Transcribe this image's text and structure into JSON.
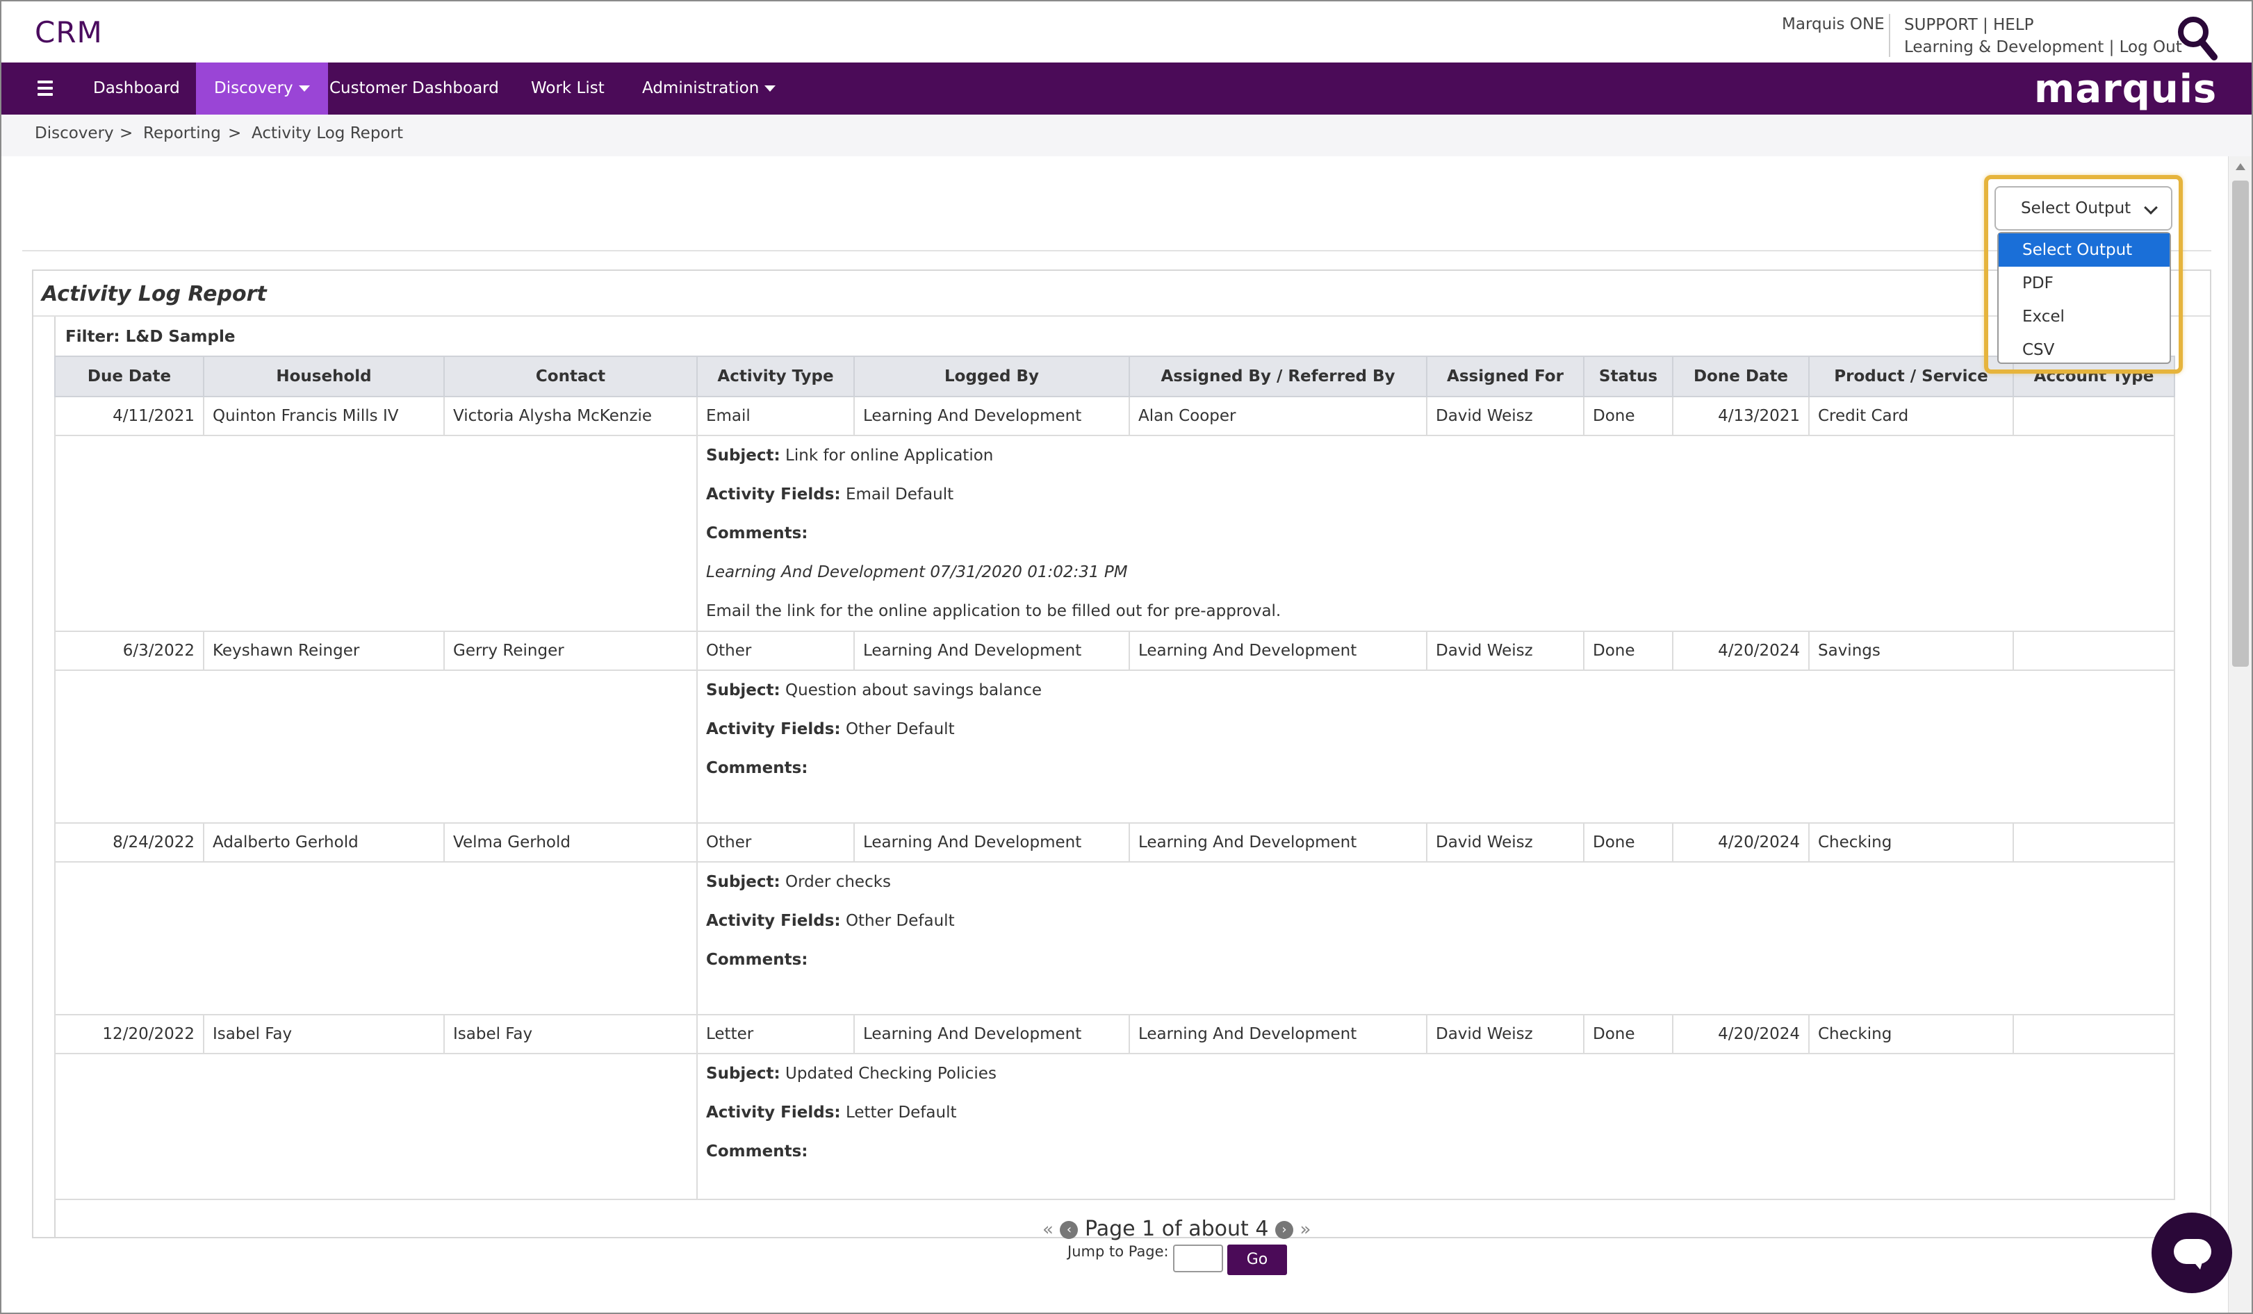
{
  "header": {
    "app_title": "CRM",
    "org_name": "Marquis ONE",
    "support_label": "SUPPORT",
    "help_label": "HELP",
    "separator": "|",
    "department": "Learning & Development",
    "logout_label": "Log Out",
    "search_icon": "search-icon",
    "brand": "marquis"
  },
  "nav": {
    "menu_icon": "hamburger-icon",
    "items": [
      {
        "label": "Dashboard"
      },
      {
        "label": "Discovery",
        "active": true,
        "has_dropdown": true
      },
      {
        "label": "Customer Dashboard"
      },
      {
        "label": "Work List"
      },
      {
        "label": "Administration",
        "has_dropdown": true
      }
    ],
    "accent_color": "#4b0b58",
    "active_color": "#9a45d6"
  },
  "breadcrumb": {
    "items": [
      "Discovery",
      "Reporting",
      "Activity Log Report"
    ],
    "separator": ">"
  },
  "output_select": {
    "selected": "Select Output",
    "options": [
      "Select Output",
      "PDF",
      "Excel",
      "CSV"
    ],
    "highlight_color": "#e6b43c"
  },
  "report": {
    "title": "Activity Log Report",
    "filter": "Filter: L&D Sample",
    "columns": [
      "Due Date",
      "Household",
      "Contact",
      "Activity Type",
      "Logged By",
      "Assigned By / Referred By",
      "Assigned For",
      "Status",
      "Done Date",
      "Product / Service",
      "Account Type"
    ],
    "labels": {
      "subject": "Subject:",
      "activity_fields": "Activity Fields:",
      "comments": "Comments:"
    },
    "rows": [
      {
        "due_date": "4/11/2021",
        "household": "Quinton Francis Mills IV",
        "contact": "Victoria Alysha McKenzie",
        "activity_type": "Email",
        "logged_by": "Learning And Development",
        "assigned_by": "Alan Cooper",
        "assigned_for": "David Weisz",
        "status": "Done",
        "done_date": "4/13/2021",
        "product": "Credit Card",
        "account_type": "",
        "subject": "Link for online Application",
        "activity_fields": "Email Default",
        "comment_meta": "Learning And Development 07/31/2020 01:02:31 PM",
        "comment_text": "Email the link for the online application to be filled out for pre-approval."
      },
      {
        "due_date": "6/3/2022",
        "household": "Keyshawn Reinger",
        "contact": "Gerry Reinger",
        "activity_type": "Other",
        "logged_by": "Learning And Development",
        "assigned_by": "Learning And Development",
        "assigned_for": "David Weisz",
        "status": "Done",
        "done_date": "4/20/2024",
        "product": "Savings",
        "account_type": "",
        "subject": "Question about savings balance",
        "activity_fields": "Other Default"
      },
      {
        "due_date": "8/24/2022",
        "household": "Adalberto Gerhold",
        "contact": "Velma Gerhold",
        "activity_type": "Other",
        "logged_by": "Learning And Development",
        "assigned_by": "Learning And Development",
        "assigned_for": "David Weisz",
        "status": "Done",
        "done_date": "4/20/2024",
        "product": "Checking",
        "account_type": "",
        "subject": "Order checks",
        "activity_fields": "Other Default"
      },
      {
        "due_date": "12/20/2022",
        "household": "Isabel Fay",
        "contact": "Isabel Fay",
        "activity_type": "Letter",
        "logged_by": "Learning And Development",
        "assigned_by": "Learning And Development",
        "assigned_for": "David Weisz",
        "status": "Done",
        "done_date": "4/20/2024",
        "product": "Checking",
        "account_type": "",
        "subject": "Updated Checking Policies",
        "activity_fields": "Letter Default"
      }
    ]
  },
  "pagination": {
    "text": "Page 1 of about 4",
    "first_icon": "«",
    "last_icon": "»",
    "prev_icon": "‹",
    "next_icon": "›",
    "jump_label": "Jump to Page:",
    "jump_value": "",
    "go_label": "Go"
  },
  "chat": {
    "icon": "chat-icon"
  }
}
